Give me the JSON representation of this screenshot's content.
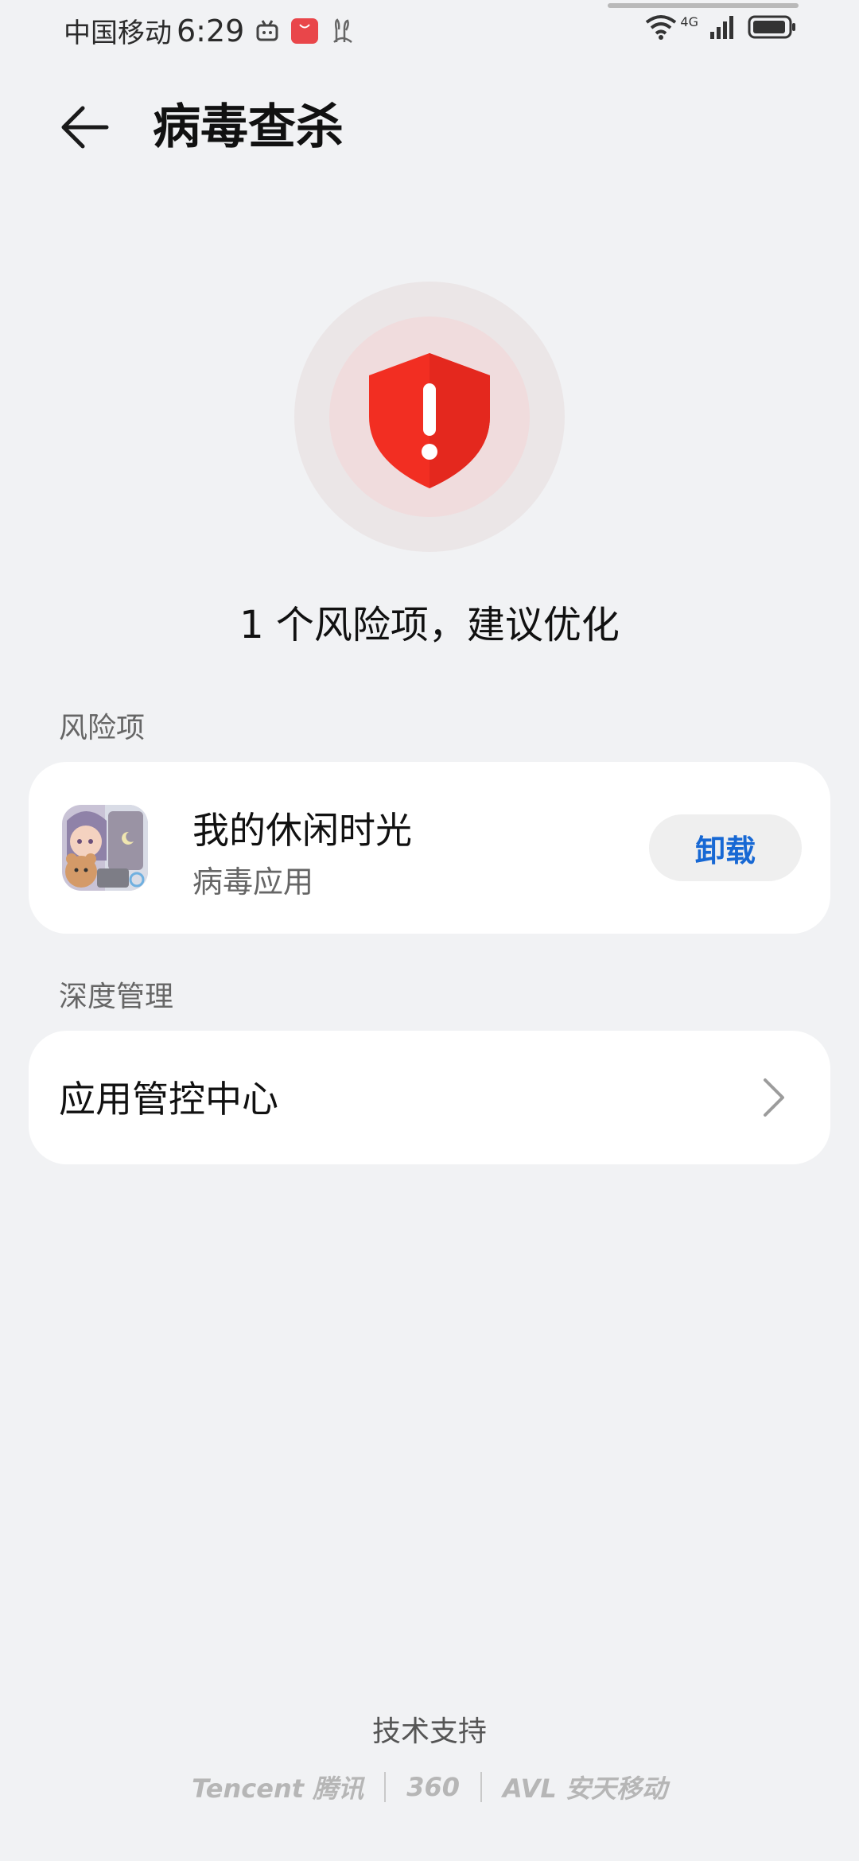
{
  "status_bar": {
    "carrier": "中国移动",
    "time": "6:29",
    "network": "4G"
  },
  "header": {
    "title": "病毒查杀"
  },
  "summary": {
    "text": "1 个风险项，建议优化"
  },
  "risk_section": {
    "label": "风险项",
    "items": [
      {
        "name": "我的休闲时光",
        "desc": "病毒应用",
        "action": "卸载"
      }
    ]
  },
  "deep_section": {
    "label": "深度管理",
    "item_label": "应用管控中心"
  },
  "footer": {
    "label": "技术支持",
    "vendors": [
      "Tencent 腾讯",
      "360",
      "AVL 安天移动"
    ]
  },
  "colors": {
    "background": "#f1f2f4",
    "shield_red": "#f22e22",
    "accent_blue": "#1768d4"
  }
}
